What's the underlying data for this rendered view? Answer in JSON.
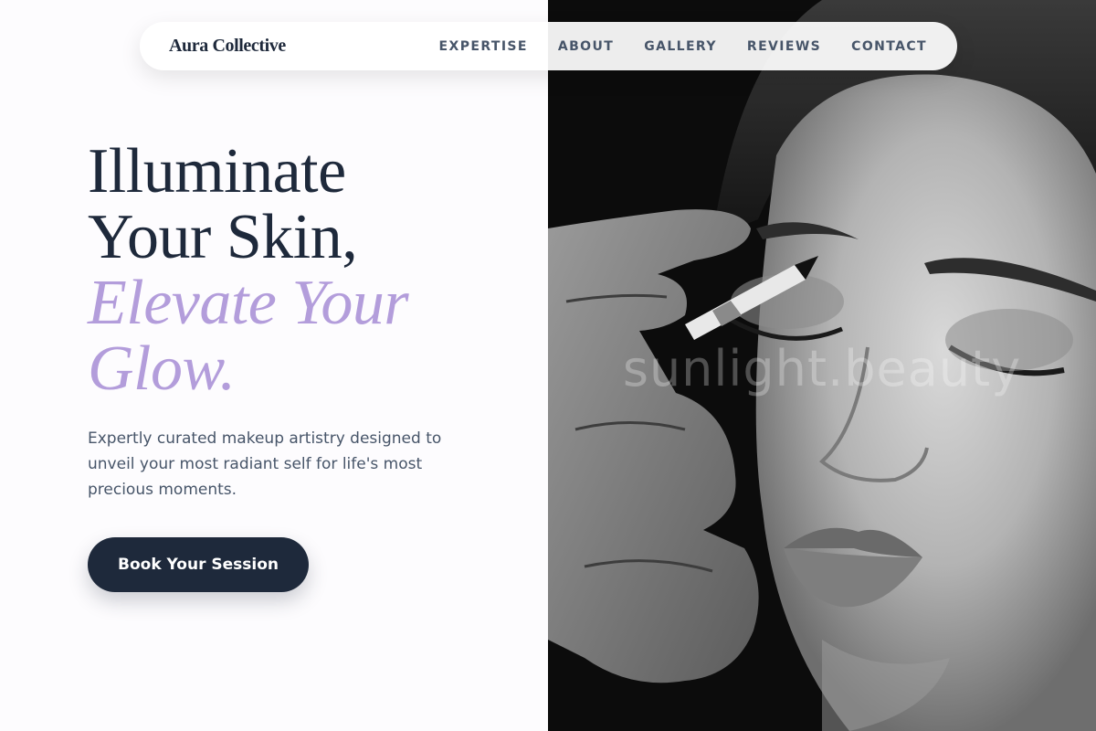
{
  "nav": {
    "brand": "Aura Collective",
    "links": [
      "EXPERTISE",
      "ABOUT",
      "GALLERY",
      "REVIEWS",
      "CONTACT"
    ]
  },
  "hero": {
    "headline_line1": "Illuminate",
    "headline_line2": "Your Skin,",
    "headline_accent1": "Elevate Your",
    "headline_accent2": "Glow.",
    "subtext": "Expertly curated makeup artistry designed to unveil your most radiant self for life's most precious moments.",
    "cta_label": "Book Your Session"
  },
  "image": {
    "watermark": "sunlight.beauty"
  },
  "colors": {
    "primary": "#1e293b",
    "accent": "#b39ddb",
    "body_text": "#475569",
    "background": "#fdfcfe"
  }
}
